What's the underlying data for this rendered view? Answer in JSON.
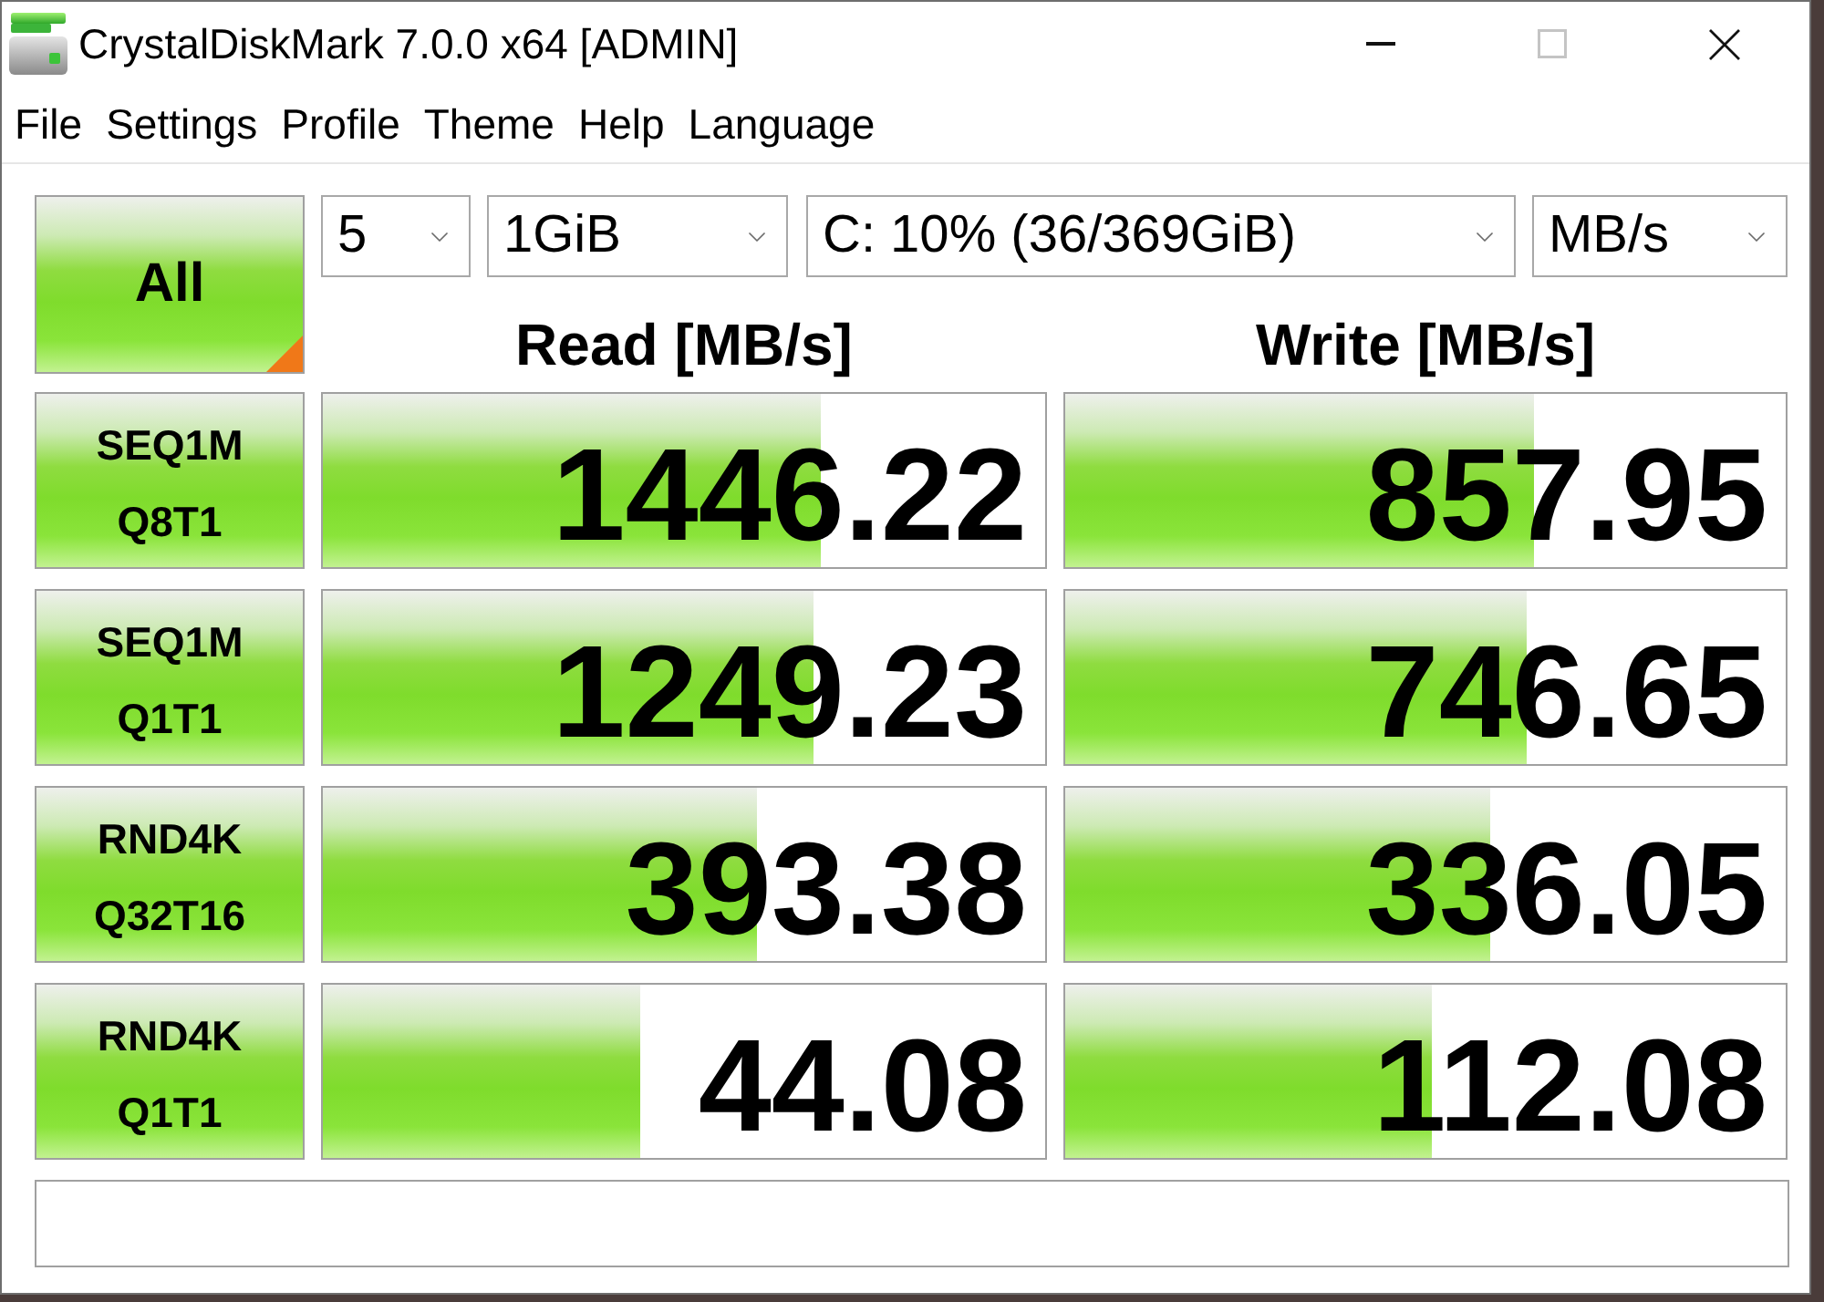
{
  "window": {
    "title": "CrystalDiskMark 7.0.0 x64 [ADMIN]",
    "maximize": {
      "disabled": true
    }
  },
  "menu": [
    "File",
    "Settings",
    "Profile",
    "Theme",
    "Help",
    "Language"
  ],
  "all_button": {
    "label": "All"
  },
  "dropdowns": [
    {
      "value": "5"
    },
    {
      "value": "1GiB"
    },
    {
      "value": "C: 10% (36/369GiB)"
    },
    {
      "value": "MB/s"
    }
  ],
  "columns": [
    "Read [MB/s]",
    "Write [MB/s]"
  ],
  "tests": [
    {
      "label": [
        "SEQ1M",
        "Q8T1"
      ],
      "read": {
        "value": "1446.22",
        "level": 0.69
      },
      "write": {
        "value": "857.95",
        "level": 0.65
      }
    },
    {
      "label": [
        "SEQ1M",
        "Q1T1"
      ],
      "read": {
        "value": "1249.23",
        "level": 0.68
      },
      "write": {
        "value": "746.65",
        "level": 0.64
      }
    },
    {
      "label": [
        "RND4K",
        "Q32T16"
      ],
      "read": {
        "value": "393.38",
        "level": 0.6
      },
      "write": {
        "value": "336.05",
        "level": 0.59
      }
    },
    {
      "label": [
        "RND4K",
        "Q1T1"
      ],
      "read": {
        "value": "44.08",
        "level": 0.44
      },
      "write": {
        "value": "112.08",
        "level": 0.51
      }
    }
  ]
}
